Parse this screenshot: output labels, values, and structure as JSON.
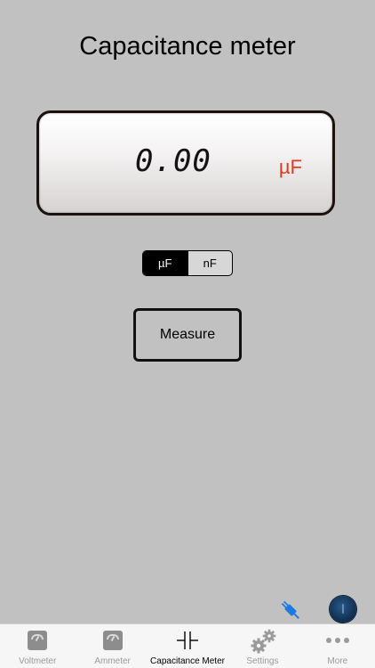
{
  "header": {
    "title": "Capacitance meter"
  },
  "display": {
    "value": "0.00",
    "unit": "µF",
    "unit_color": "#e23a1e"
  },
  "unit_selector": {
    "options": [
      {
        "label": "µF",
        "selected": true
      },
      {
        "label": "nF",
        "selected": false
      }
    ]
  },
  "actions": {
    "measure_label": "Measure"
  },
  "floating_icons": [
    "plug-icon",
    "power-icon"
  ],
  "tabbar": {
    "items": [
      {
        "label": "Voltmeter",
        "icon": "meter-icon",
        "active": false
      },
      {
        "label": "Ammeter",
        "icon": "meter-icon",
        "active": false
      },
      {
        "label": "Capacitance Meter",
        "icon": "capacitor-icon",
        "active": true
      },
      {
        "label": "Settings",
        "icon": "gears-icon",
        "active": false
      },
      {
        "label": "More",
        "icon": "more-dots-icon",
        "active": false
      }
    ]
  }
}
